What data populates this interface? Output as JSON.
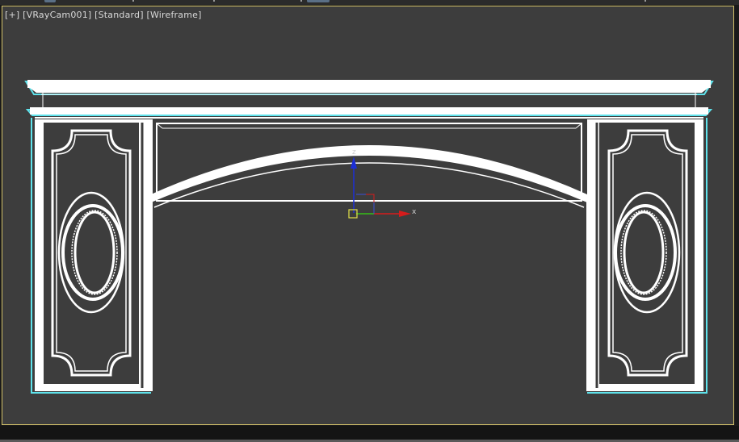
{
  "viewport": {
    "label_plus": "[+]",
    "label_camera": "[VRayCam001]",
    "label_shading_1": "[Standard]",
    "label_shading_2": "[Wireframe]"
  },
  "gizmo": {
    "z_label": "z",
    "x_label": "x"
  },
  "colors": {
    "viewport_bg": "#3d3d3d",
    "active_border": "#d4c26a",
    "wire_white": "#ffffff",
    "wire_selection": "#5fe3ec",
    "axis_z": "#1c2fd6",
    "axis_x": "#d61c1c",
    "axis_y": "#1cc41c",
    "pivot_box": "#e3e14a"
  },
  "icons": {
    "transform_gizmo": "xyz-transform-gizmo-icon"
  }
}
